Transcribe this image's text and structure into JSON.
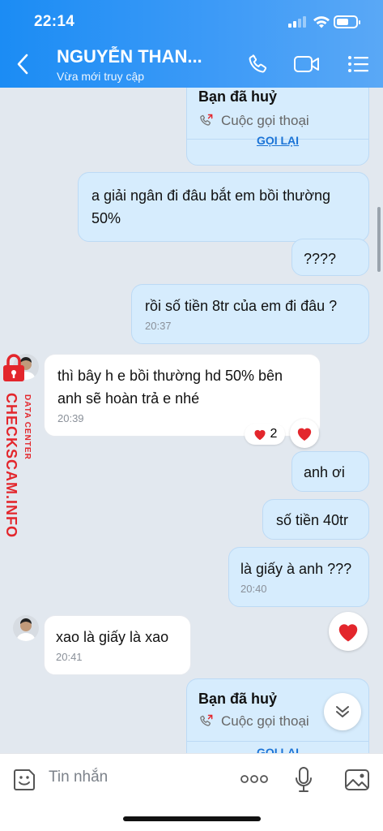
{
  "status": {
    "time": "22:14"
  },
  "header": {
    "title": "NGUYỄN THAN...",
    "subtitle": "Vừa mới truy cập"
  },
  "call_cards": [
    {
      "title": "Bạn đã huỷ",
      "type": "Cuộc gọi thoại",
      "action": "GỌI LẠI"
    },
    {
      "title": "Bạn đã huỷ",
      "type": "Cuộc gọi thoại",
      "action": "GỌI LẠI"
    }
  ],
  "messages": [
    {
      "text": "a giải ngân đi đâu bắt em bồi thường 50%",
      "time": ""
    },
    {
      "text": "????",
      "time": ""
    },
    {
      "text": "rồi số tiền 8tr của em đi đâu ?",
      "time": "20:37"
    },
    {
      "text": "thì bây h e bồi thường hd 50% bên anh sẽ hoàn trả e nhé",
      "time": "20:39",
      "reaction_count": "2"
    },
    {
      "text": "anh ơi",
      "time": ""
    },
    {
      "text": "số tiền 40tr",
      "time": ""
    },
    {
      "text": "là giấy à anh ???",
      "time": "20:40"
    },
    {
      "text": "xao là giấy là xao",
      "time": "20:41"
    }
  ],
  "watermark": {
    "brand": "CHECKSCAM.INFO",
    "tag": "DATA CENTER"
  },
  "input": {
    "placeholder": "Tin nhắn"
  },
  "colors": {
    "header_start": "#1b8cf4",
    "outgoing_bubble": "#d6ecfd",
    "incoming_bubble": "#ffffff",
    "heart": "#e3262c",
    "link": "#1a73d6"
  }
}
